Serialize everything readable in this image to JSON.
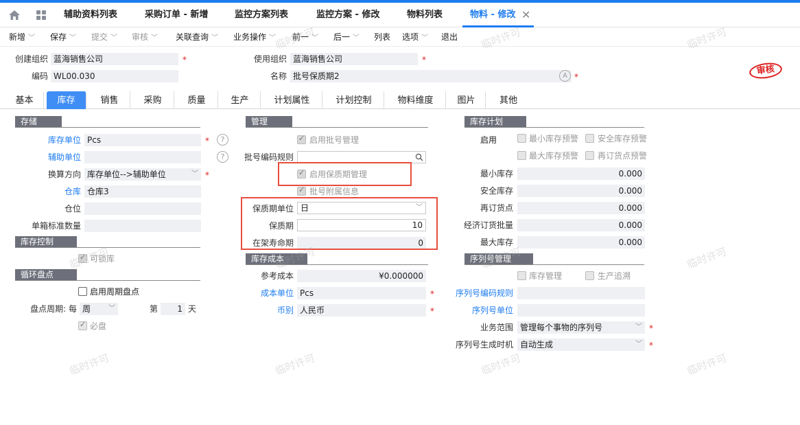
{
  "tabs": [
    {
      "label": "辅助资料列表"
    },
    {
      "label": "采购订单 - 新增"
    },
    {
      "label": "监控方案列表"
    },
    {
      "label": "监控方案 - 修改"
    },
    {
      "label": "物料列表"
    },
    {
      "label": "物料 - 修改"
    }
  ],
  "toolbar": {
    "new": "新增",
    "save": "保存",
    "submit": "提交",
    "audit": "审核",
    "related": "关联查询",
    "business": "业务操作",
    "prev": "前一",
    "next": "后一",
    "list": "列表",
    "options": "选项",
    "exit": "退出"
  },
  "header": {
    "create_org_label": "创建组织",
    "create_org_value": "蓝海销售公司",
    "use_org_label": "使用组织",
    "use_org_value": "蓝海销售公司",
    "code_label": "编码",
    "code_value": "WL00.030",
    "name_label": "名称",
    "name_value": "批号保质期2",
    "stamp": "审核",
    "watermark": "临时许可"
  },
  "subtabs": [
    "基本",
    "库存",
    "销售",
    "采购",
    "质量",
    "生产",
    "计划属性",
    "计划控制",
    "物料维度",
    "图片",
    "其他"
  ],
  "storage": {
    "title": "存储",
    "unit_label": "库存单位",
    "unit_value": "Pcs",
    "aux_unit_label": "辅助单位",
    "aux_unit_value": "",
    "conv_label": "换算方向",
    "conv_value": "库存单位-->辅助单位",
    "warehouse_label": "仓库",
    "warehouse_value": "仓库3",
    "location_label": "仓位",
    "location_value": "",
    "box_label": "单箱标准数量",
    "box_value": ""
  },
  "stock_control": {
    "title": "库存控制",
    "lockable": "可锁库"
  },
  "cycle_count": {
    "title": "循环盘点",
    "enable": "启用周期盘点",
    "period_label": "盘点周期: 每",
    "period_value": "周",
    "nth_label": "第",
    "nth_value": "1",
    "day_label": "天",
    "must": "必盘"
  },
  "management": {
    "title": "管理",
    "batch": "启用批号管理",
    "batch_rule_label": "批号编码规则",
    "batch_rule_value": "",
    "shelf_life": "启用保质期管理",
    "batch_extra": "批号附属信息",
    "shelf_unit_label": "保质期单位",
    "shelf_unit_value": "日",
    "shelf_label": "保质期",
    "shelf_value": "10",
    "shelf_remain_label": "在架寿命期",
    "shelf_remain_value": "0"
  },
  "cost": {
    "title": "库存成本",
    "ref_label": "参考成本",
    "ref_value": "¥0.000000",
    "unit_label": "成本单位",
    "unit_value": "Pcs",
    "currency_label": "币别",
    "currency_value": "人民币"
  },
  "plan": {
    "title": "库存计划",
    "enable_label": "启用",
    "min_alert": "最小库存预警",
    "safe_alert": "安全库存预警",
    "max_alert": "最大库存预警",
    "reorder_alert": "再订货点预警",
    "min_label": "最小库存",
    "min_value": "0.000",
    "safe_label": "安全库存",
    "safe_value": "0.000",
    "reorder_label": "再订货点",
    "reorder_value": "0.000",
    "eoq_label": "经济订货批量",
    "eoq_value": "0.000",
    "max_label": "最大库存",
    "max_value": "0.000"
  },
  "serial": {
    "title": "序列号管理",
    "stock_mgmt": "库存管理",
    "trace": "生产追溯",
    "rule_label": "序列号编码规则",
    "rule_value": "",
    "unit_label": "序列号单位",
    "unit_value": "",
    "scope_label": "业务范围",
    "scope_value": "管理每个事物的序列号",
    "gen_label": "序列号生成时机",
    "gen_value": "自动生成"
  },
  "colors": {
    "accent": "#1e7cf0",
    "section_header": "#6d6f7a",
    "highlight_box": "#e84d3d"
  }
}
